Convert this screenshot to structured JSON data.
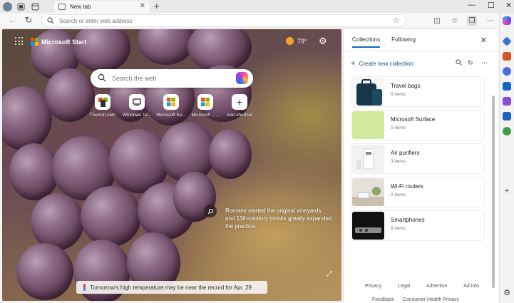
{
  "browser": {
    "tab_title": "New tab",
    "address_placeholder": "Search or enter web address"
  },
  "hero": {
    "brand": "Microsoft Start",
    "temperature": "79°",
    "search_placeholder": "Search the web",
    "shortcuts": [
      {
        "label": "Thurrott.com",
        "icon": "thurrott-icon"
      },
      {
        "label": "Windows 11...",
        "icon": "windows-icon"
      },
      {
        "label": "Microsoft Su...",
        "icon": "microsoft-icon"
      },
      {
        "label": "Microsoft – ...",
        "icon": "microsoft-icon"
      },
      {
        "label": "Add shortcut",
        "icon": "plus-icon"
      }
    ],
    "caption": "Romans started the original vineyards, and 13th-century monks greatly expanded the practice.",
    "banner": "Tomorrow's high temperature may be near the record for Apr. 29"
  },
  "collections": {
    "tabs": [
      "Collections",
      "Following"
    ],
    "new_collection": "Create new collection",
    "items": [
      {
        "title": "Travel bags",
        "count": "5 items"
      },
      {
        "title": "Microsoft Surface",
        "count": "5 items"
      },
      {
        "title": "Air purifiers",
        "count": "3 items"
      },
      {
        "title": "Wi-Fi routers",
        "count": "2 items"
      },
      {
        "title": "Smartphones",
        "count": "8 items"
      }
    ],
    "footer": [
      "Privacy",
      "Legal",
      "Advertise",
      "Ad info"
    ],
    "footer2": [
      "Feedback",
      "Consumer Health Privacy"
    ]
  },
  "colors": {
    "accent": "#0f6cbd",
    "surface_thumb": "#d3ea9c"
  }
}
